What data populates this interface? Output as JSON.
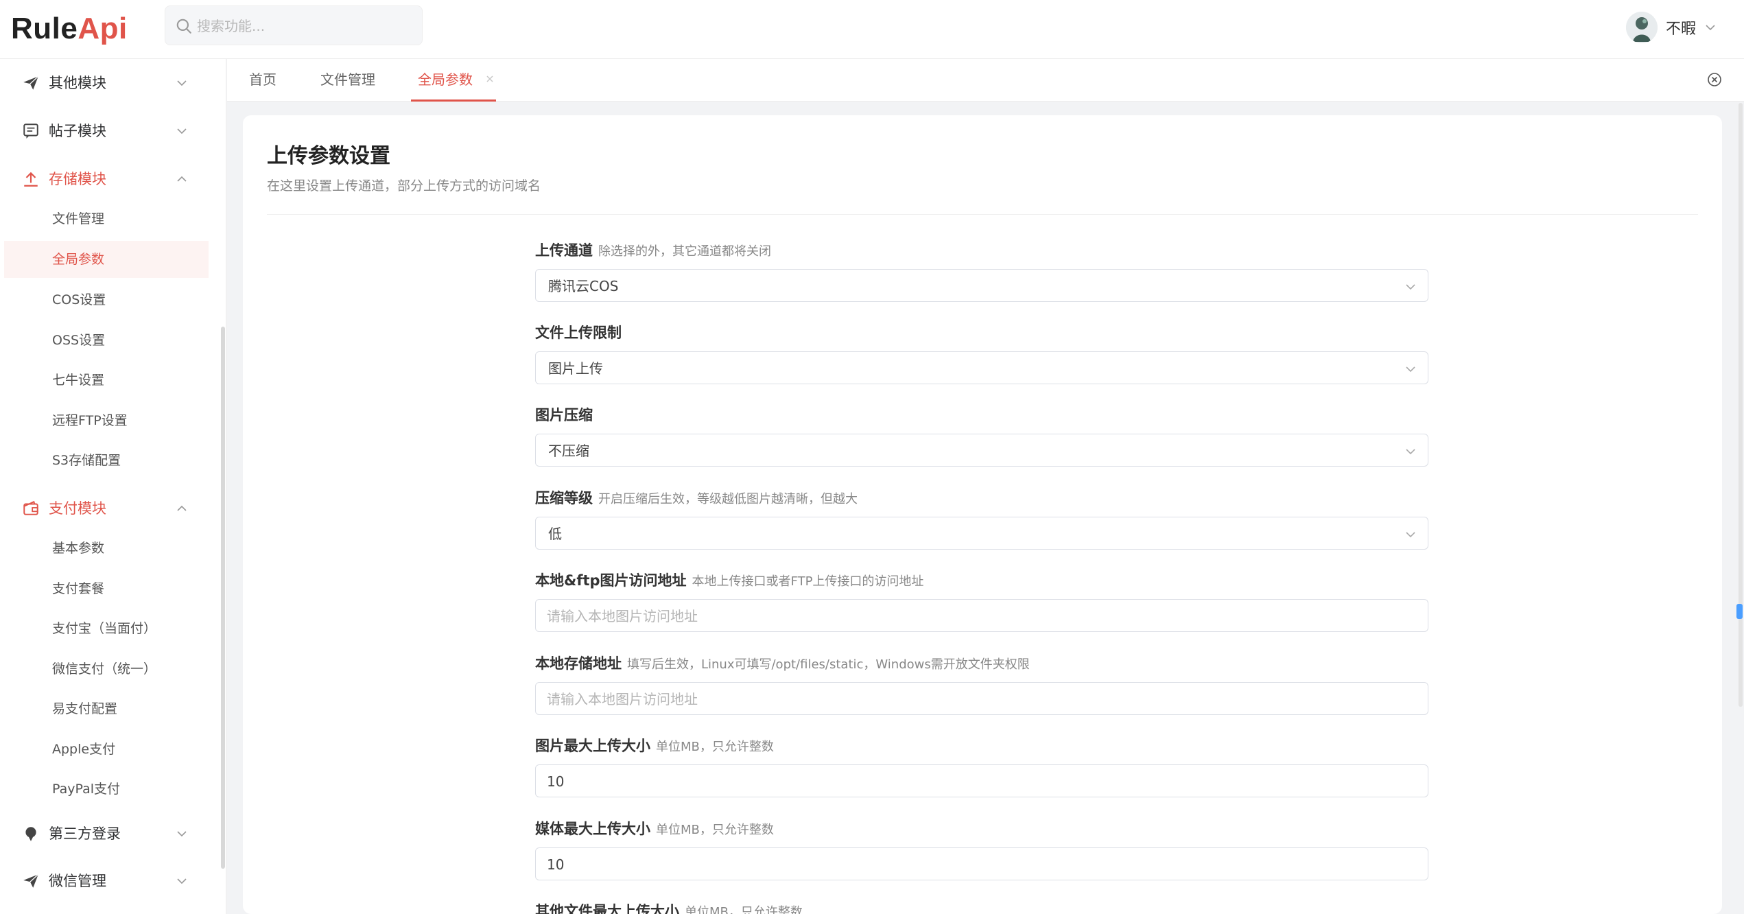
{
  "app": {
    "logo_main": "Rule",
    "logo_accent": "Api",
    "search_placeholder": "搜索功能...",
    "user_name": "不暇"
  },
  "sidebar": {
    "groups": [
      {
        "label": "其他模块",
        "icon": "paper-plane-icon",
        "expanded": false
      },
      {
        "label": "帖子模块",
        "icon": "message-icon",
        "expanded": false
      },
      {
        "label": "存储模块",
        "icon": "upload-icon",
        "expanded": true
      },
      {
        "label": "支付模块",
        "icon": "wallet-icon",
        "expanded": true
      },
      {
        "label": "第三方登录",
        "icon": "pin-icon",
        "expanded": false
      },
      {
        "label": "微信管理",
        "icon": "paper-plane-icon",
        "expanded": false
      }
    ],
    "storage_items": [
      "文件管理",
      "全局参数",
      "COS设置",
      "OSS设置",
      "七牛设置",
      "远程FTP设置",
      "S3存储配置"
    ],
    "payment_items": [
      "基本参数",
      "支付套餐",
      "支付宝（当面付）",
      "微信支付（统一）",
      "易支付配置",
      "Apple支付",
      "PayPal支付"
    ],
    "active_item": "全局参数"
  },
  "tabs": [
    {
      "label": "首页",
      "active": false
    },
    {
      "label": "文件管理",
      "active": false
    },
    {
      "label": "全局参数",
      "active": true
    }
  ],
  "page": {
    "title": "上传参数设置",
    "description": "在这里设置上传通道，部分上传方式的访问域名"
  },
  "form": {
    "upload_channel": {
      "label": "上传通道",
      "hint": "除选择的外，其它通道都将关闭",
      "value": "腾讯云COS"
    },
    "upload_limit": {
      "label": "文件上传限制",
      "hint": "",
      "value": "图片上传"
    },
    "image_compress": {
      "label": "图片压缩",
      "hint": "",
      "value": "不压缩"
    },
    "compress_level": {
      "label": "压缩等级",
      "hint": "开启压缩后生效，等级越低图片越清晰，但越大",
      "value": "低"
    },
    "local_ftp_url": {
      "label": "本地&ftp图片访问地址",
      "hint": "本地上传接口或者FTP上传接口的访问地址",
      "placeholder": "请输入本地图片访问地址",
      "value": ""
    },
    "local_storage_path": {
      "label": "本地存储地址",
      "hint": "填写后生效，Linux可填写/opt/files/static，Windows需开放文件夹权限",
      "placeholder": "请输入本地图片访问地址",
      "value": ""
    },
    "image_max_size": {
      "label": "图片最大上传大小",
      "hint": "单位MB，只允许整数",
      "value": "10"
    },
    "media_max_size": {
      "label": "媒体最大上传大小",
      "hint": "单位MB，只允许整数",
      "value": "10"
    },
    "other_max_size": {
      "label": "其他文件最大上传大小",
      "hint": "单位MB，只允许整数"
    }
  },
  "colors": {
    "accent": "#e0544a",
    "scroll_thumb": "#4a9eff"
  }
}
